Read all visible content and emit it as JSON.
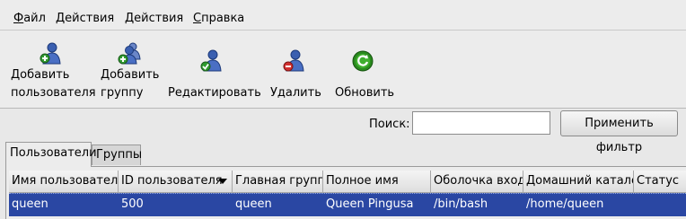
{
  "menu": {
    "items": [
      "Файл",
      "Действия",
      "Действия",
      "Справка"
    ]
  },
  "toolbar": {
    "add_user": [
      "Добавить",
      "пользователя"
    ],
    "add_group": [
      "Добавить",
      "группу"
    ],
    "edit": "Редактировать",
    "delete": "Удалить",
    "refresh": "Обновить"
  },
  "search": {
    "label": "Поиск:",
    "value": "",
    "apply_label": "Применить фильтр"
  },
  "tabs": [
    {
      "label": "Пользователи",
      "active": true
    },
    {
      "label": "Группы",
      "active": false
    }
  ],
  "table": {
    "columns": [
      "Имя пользователя",
      "ID пользователя",
      "Главная группа",
      "Полное имя",
      "Оболочка входа",
      "Домашний каталог",
      "Статус"
    ],
    "sorted_column": "ID пользователя",
    "rows": [
      [
        "queen",
        "500",
        "queen",
        "Queen Pingusa",
        "/bin/bash",
        "/home/queen",
        ""
      ]
    ]
  },
  "colors": {
    "selection": "#2a47a3",
    "user_icon": "#3a5fb0",
    "add_badge": "#2f9a2f",
    "delete_badge": "#d23030",
    "refresh_icon": "#2a8a1e"
  },
  "icons": {
    "add_user": "user-add-icon",
    "add_group": "group-add-icon",
    "edit": "user-edit-icon",
    "delete": "user-delete-icon",
    "refresh": "refresh-icon"
  }
}
